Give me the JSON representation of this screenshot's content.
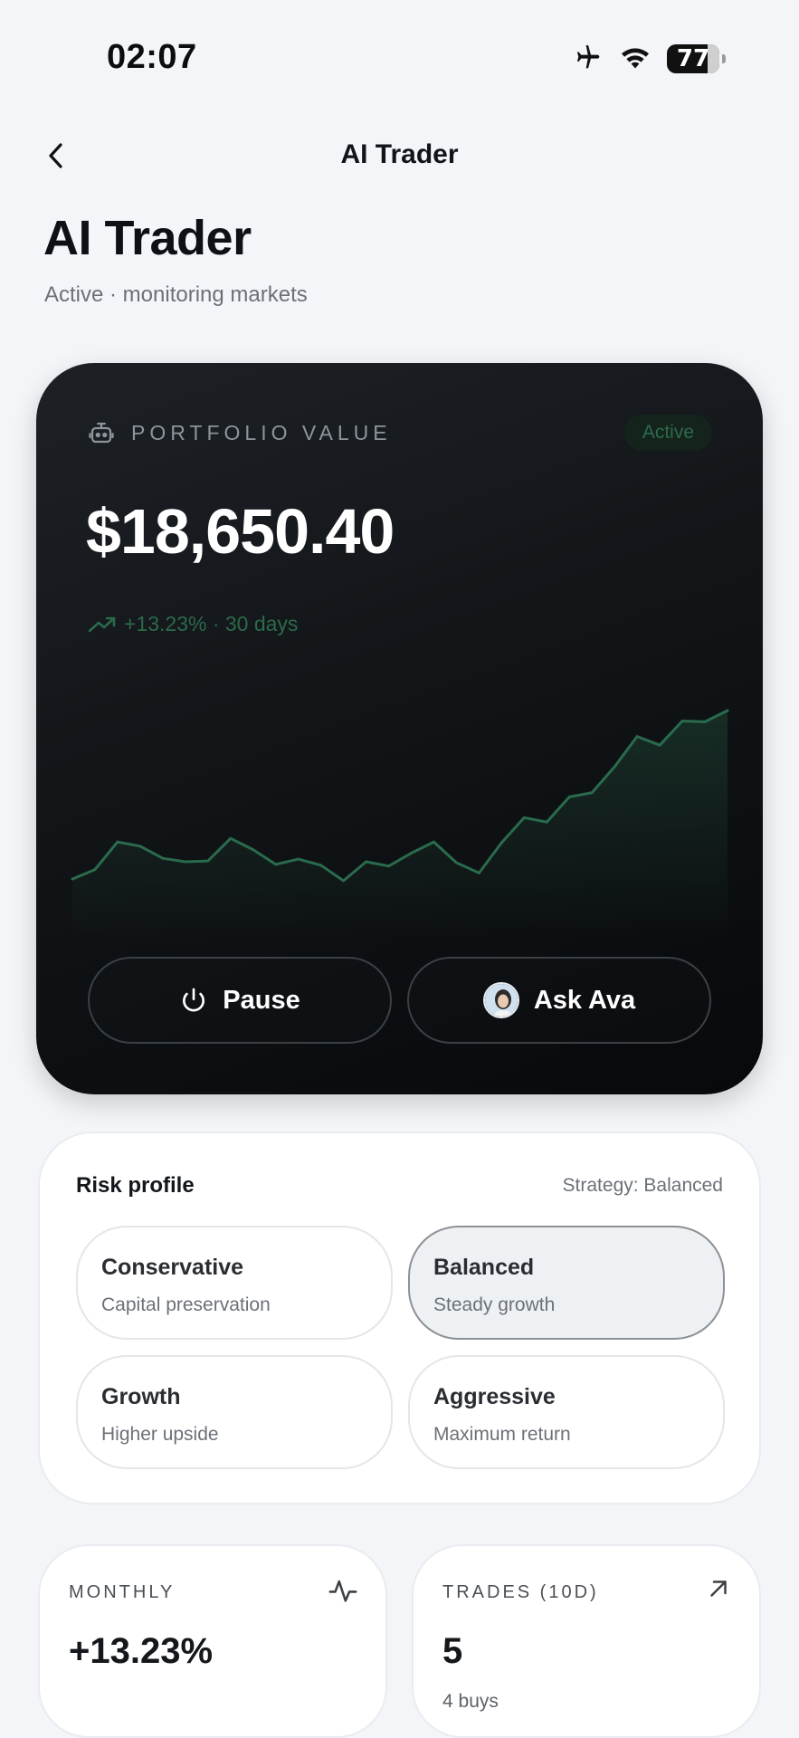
{
  "status_bar": {
    "time": "02:07",
    "icons": [
      "airplane-icon",
      "wifi-icon",
      "battery-icon"
    ],
    "battery": "77"
  },
  "nav": {
    "title": "AI Trader",
    "back_icon": "chevron-left-icon"
  },
  "header": {
    "title": "AI Trader",
    "subtitle": "Active · monitoring markets"
  },
  "portfolio": {
    "label": "PORTFOLIO VALUE",
    "label_icon": "robot-icon",
    "badge": "Active",
    "value": "$18,650.40",
    "change": "+13.23% · 30 days",
    "change_icon": "trending-up-icon",
    "colors": {
      "card_bg": "#121518",
      "accent_green": "#2b6a4b",
      "line": "#2a6b4d"
    },
    "pause_label": "Pause",
    "pause_icon": "power-icon",
    "ask_label": "Ask Ava",
    "ask_icon": "ava-avatar"
  },
  "chart_data": {
    "type": "area",
    "title": "",
    "xlabel": "",
    "ylabel": "",
    "grid": false,
    "values": [
      100,
      101.1,
      104.3,
      103.8,
      102.4,
      102.0,
      102.1,
      104.7,
      103.4,
      101.7,
      102.3,
      101.6,
      99.8,
      102.0,
      101.5,
      103.0,
      104.3,
      101.9,
      100.7,
      104.2,
      107.1,
      106.6,
      109.5,
      110.0,
      113.0,
      116.5,
      115.5,
      118.3,
      118.2,
      119.5
    ]
  },
  "risk": {
    "title": "Risk profile",
    "strategy": "Strategy: Balanced",
    "options": [
      {
        "name": "Conservative",
        "desc": "Capital preservation",
        "selected": false
      },
      {
        "name": "Balanced",
        "desc": "Steady growth",
        "selected": true
      },
      {
        "name": "Growth",
        "desc": "Higher upside",
        "selected": false
      },
      {
        "name": "Aggressive",
        "desc": "Maximum return",
        "selected": false
      }
    ]
  },
  "stats": {
    "monthly": {
      "label": "MONTHLY",
      "value": "+13.23%",
      "icon": "activity-pulse-icon"
    },
    "trades": {
      "label": "TRADES (10D)",
      "value": "5",
      "sub": "4 buys",
      "icon": "arrow-up-right-icon"
    }
  }
}
